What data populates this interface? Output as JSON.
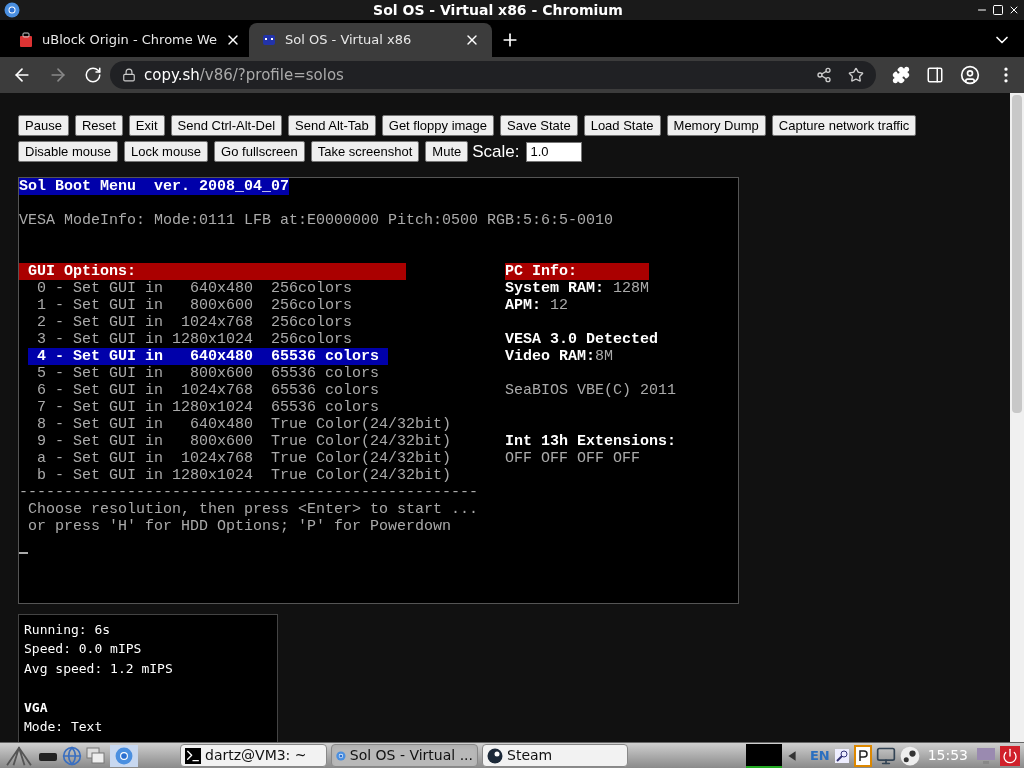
{
  "window": {
    "title": "Sol OS - Virtual x86 - Chromium"
  },
  "tabs": [
    {
      "title": "uBlock Origin - Chrome We",
      "selected": false
    },
    {
      "title": "Sol OS - Virtual x86",
      "selected": true
    }
  ],
  "address_bar": {
    "host": "copy.sh",
    "path": "/v86/?profile=solos"
  },
  "toolbar": {
    "buttons": [
      "Pause",
      "Reset",
      "Exit",
      "Send Ctrl-Alt-Del",
      "Send Alt-Tab",
      "Get floppy image",
      "Save State",
      "Load State",
      "Memory Dump",
      "Capture network traffic",
      "Disable mouse",
      "Lock mouse",
      "Go fullscreen",
      "Take screenshot",
      "Mute"
    ],
    "scale_label": "Scale:",
    "scale_value": "1.0"
  },
  "screen": {
    "header": "Sol Boot Menu  ver. 2008_04_07",
    "mode_info": "VESA ModeInfo: Mode:0111 LFB at:E0000000 Pitch:0500 RGB:5:6:5-0010",
    "gui_title": "GUI Options:",
    "options": [
      {
        "text": "0 - Set GUI in   640x480  256colors",
        "selected": false
      },
      {
        "text": "1 - Set GUI in   800x600  256colors",
        "selected": false
      },
      {
        "text": "2 - Set GUI in  1024x768  256colors",
        "selected": false
      },
      {
        "text": "3 - Set GUI in 1280x1024  256colors",
        "selected": false
      },
      {
        "text": "4 - Set GUI in   640x480  65536 colors",
        "selected": true
      },
      {
        "text": "5 - Set GUI in   800x600  65536 colors",
        "selected": false
      },
      {
        "text": "6 - Set GUI in  1024x768  65536 colors",
        "selected": false
      },
      {
        "text": "7 - Set GUI in 1280x1024  65536 colors",
        "selected": false
      },
      {
        "text": "8 - Set GUI in   640x480  True Color(24/32bit)",
        "selected": false
      },
      {
        "text": "9 - Set GUI in   800x600  True Color(24/32bit)",
        "selected": false
      },
      {
        "text": "a - Set GUI in  1024x768  True Color(24/32bit)",
        "selected": false
      },
      {
        "text": "b - Set GUI in 1280x1024  True Color(24/32bit)",
        "selected": false
      }
    ],
    "separator": "---------------------------------------------------",
    "prompt_lines": [
      "Choose resolution, then press <Enter> to start ...",
      "or press 'H' for HDD Options; 'P' for Powerdown"
    ],
    "pc_info_title": "PC Info:",
    "pc_info": [
      {
        "kind": "pair",
        "label": "System RAM:",
        "value": " 128M"
      },
      {
        "kind": "pair",
        "label": "APM:",
        "value": " 12"
      },
      {
        "kind": "blank"
      },
      {
        "kind": "bright",
        "text": "VESA 3.0 Detected"
      },
      {
        "kind": "pair",
        "label": "Video RAM:",
        "value": "8M"
      },
      {
        "kind": "blank"
      },
      {
        "kind": "plain",
        "text": "SeaBIOS VBE(C) 2011"
      },
      {
        "kind": "blank"
      },
      {
        "kind": "blank"
      },
      {
        "kind": "bright",
        "text": "Int 13h Extensions:"
      },
      {
        "kind": "plain",
        "text": "OFF OFF OFF OFF"
      }
    ]
  },
  "stats": [
    {
      "kind": "line",
      "text": "Running: 6s"
    },
    {
      "kind": "line",
      "text": "Speed: 0.0 mIPS"
    },
    {
      "kind": "line",
      "text": "Avg speed: 1.2 mIPS"
    },
    {
      "kind": "blank"
    },
    {
      "kind": "heading",
      "text": "VGA"
    },
    {
      "kind": "line",
      "text": "Mode: Text"
    }
  ],
  "taskbar": {
    "windows": [
      {
        "title": "dartz@VM3: ~",
        "selected": false
      },
      {
        "title": "Sol OS - Virtual ...",
        "selected": true
      },
      {
        "title": "Steam",
        "selected": false
      }
    ],
    "language": "EN",
    "clock": "15:53"
  }
}
